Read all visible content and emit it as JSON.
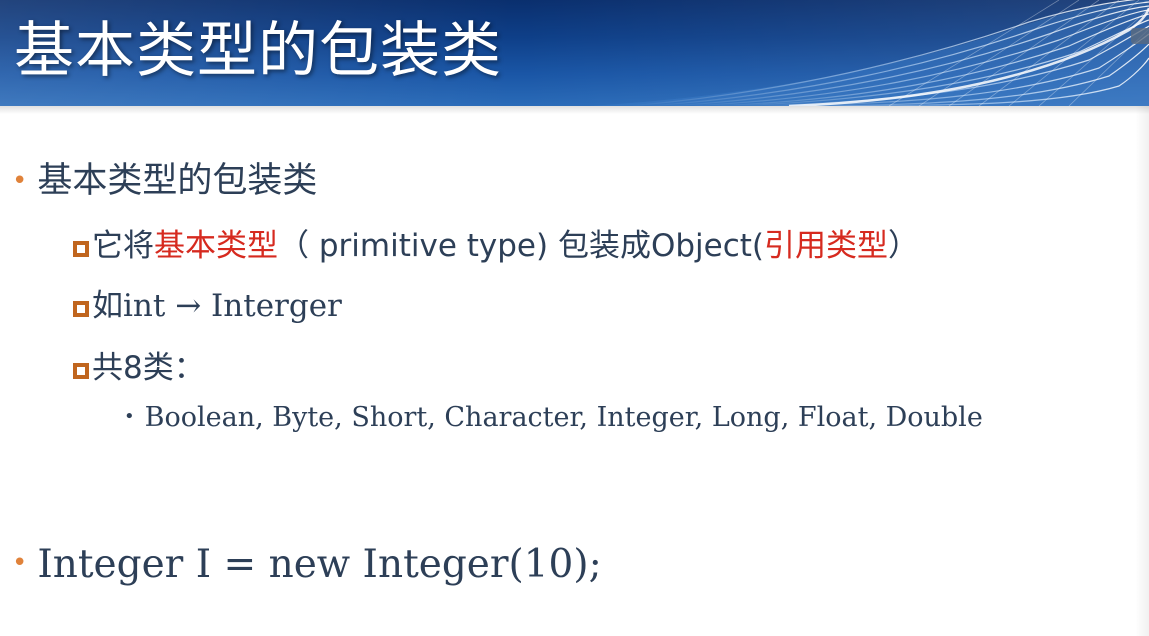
{
  "slide": {
    "title": "基本类型的包装类"
  },
  "bullets": {
    "main": "基本类型的包装类",
    "sub1": {
      "before": "它将",
      "red1": "基本类型",
      "middle": "（ primitive type) 包装成Object(",
      "red2": "引用类型",
      "after": "）"
    },
    "sub2": {
      "cjk": "如",
      "rest": "int →  Interger"
    },
    "sub3": "共8类：",
    "types": "Boolean, Byte, Short,  Character, Integer, Long, Float, Double",
    "code": "Integer I  = new Integer(10);"
  },
  "colors": {
    "banner": "#0e3f88",
    "text": "#2d3f57",
    "bullet_dot": "#e0823a",
    "square_bullet": "#c0651e",
    "highlight_red": "#d62a1f"
  }
}
